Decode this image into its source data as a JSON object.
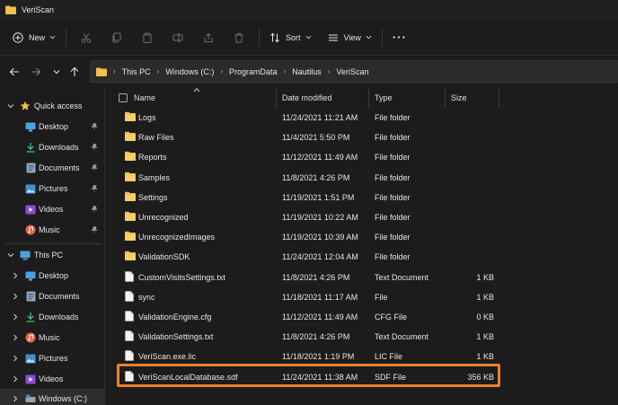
{
  "window": {
    "title": "VeriScan"
  },
  "toolbar": {
    "new_label": "New",
    "sort_label": "Sort",
    "view_label": "View",
    "more_label": "···"
  },
  "address": {
    "crumbs": [
      "This PC",
      "Windows (C:)",
      "ProgramData",
      "Nautilus",
      "VeriScan"
    ]
  },
  "sidebar": {
    "quick_access": "Quick access",
    "quick_items": [
      "Desktop",
      "Downloads",
      "Documents",
      "Pictures",
      "Videos",
      "Music"
    ],
    "this_pc": "This PC",
    "pc_items": [
      "Desktop",
      "Documents",
      "Downloads",
      "Music",
      "Pictures",
      "Videos",
      "Windows (C:)"
    ]
  },
  "columns": {
    "name": "Name",
    "date": "Date modified",
    "type": "Type",
    "size": "Size"
  },
  "files": [
    {
      "name": "Logs",
      "date": "11/24/2021 11:21 AM",
      "type": "File folder",
      "size": "",
      "kind": "folder"
    },
    {
      "name": "Raw Files",
      "date": "11/4/2021 5:50 PM",
      "type": "File folder",
      "size": "",
      "kind": "folder"
    },
    {
      "name": "Reports",
      "date": "11/12/2021 11:49 AM",
      "type": "File folder",
      "size": "",
      "kind": "folder"
    },
    {
      "name": "Samples",
      "date": "11/8/2021 4:26 PM",
      "type": "File folder",
      "size": "",
      "kind": "folder"
    },
    {
      "name": "Settings",
      "date": "11/19/2021 1:51 PM",
      "type": "File folder",
      "size": "",
      "kind": "folder"
    },
    {
      "name": "Unrecognized",
      "date": "11/19/2021 10:22 AM",
      "type": "File folder",
      "size": "",
      "kind": "folder"
    },
    {
      "name": "UnrecognizedImages",
      "date": "11/19/2021 10:39 AM",
      "type": "File folder",
      "size": "",
      "kind": "folder"
    },
    {
      "name": "ValidationSDK",
      "date": "11/24/2021 12:04 AM",
      "type": "File folder",
      "size": "",
      "kind": "folder"
    },
    {
      "name": "CustomVisitsSettings.txt",
      "date": "11/8/2021 4:26 PM",
      "type": "Text Document",
      "size": "1 KB",
      "kind": "file"
    },
    {
      "name": "sync",
      "date": "11/18/2021 11:17 AM",
      "type": "File",
      "size": "1 KB",
      "kind": "file"
    },
    {
      "name": "ValidationEngine.cfg",
      "date": "11/12/2021 11:49 AM",
      "type": "CFG File",
      "size": "0 KB",
      "kind": "file"
    },
    {
      "name": "ValidationSettings.txt",
      "date": "11/8/2021 4:26 PM",
      "type": "Text Document",
      "size": "1 KB",
      "kind": "file"
    },
    {
      "name": "VeriScan.exe.lic",
      "date": "11/18/2021 1:19 PM",
      "type": "LIC File",
      "size": "1 KB",
      "kind": "file"
    },
    {
      "name": "VeriScanLocalDatabase.sdf",
      "date": "11/24/2021 11:38 AM",
      "type": "SDF File",
      "size": "356 KB",
      "kind": "file"
    }
  ],
  "colors": {
    "folder": "#f2c14e",
    "highlight": "#f07f2d",
    "background": "#1c1c1c"
  }
}
